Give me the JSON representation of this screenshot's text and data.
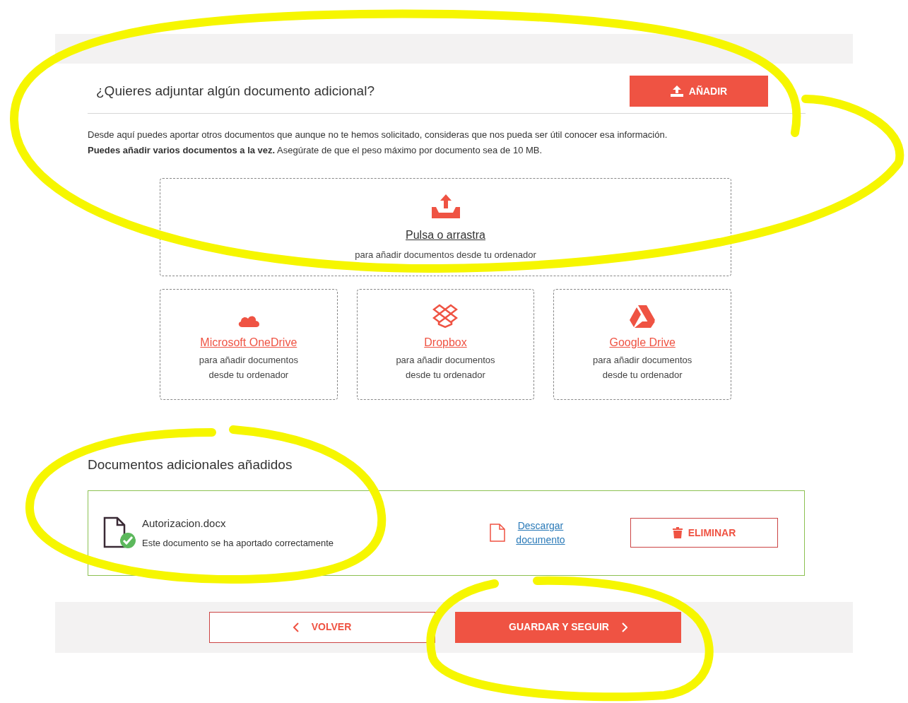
{
  "header": {
    "title": "¿Quieres adjuntar algún documento adicional?",
    "add_button": "AÑADIR"
  },
  "intro": [
    "Desde aquí puedes aportar otros documentos que aunque no te hemos solicitado, consideras que nos pueda ser útil conocer esa información.",
    "**Puedes añadir varios documentos a la vez.** Asegúrate de que el peso máximo por documento sea de 10 MB."
  ],
  "dropzone": {
    "link": "Pulsa o arrastra",
    "hint": "para añadir documentos desde tu ordenador"
  },
  "providers": [
    {
      "kind": "onedrive",
      "link": "Microsoft OneDrive",
      "hint": "para añadir documentos desde tu ordenador"
    },
    {
      "kind": "dropbox",
      "link": "Dropbox",
      "hint": "para añadir documentos desde tu ordenador"
    },
    {
      "kind": "gdrive",
      "link": "Google Drive",
      "hint": "para añadir documentos desde tu ordenador"
    }
  ],
  "added": {
    "title": "Documentos adicionales añadidos",
    "documents": [
      {
        "name": "Autorizacion.docx",
        "status": "Este documento se ha aportado correctamente",
        "uploaded": true,
        "download": "Descargar documento",
        "delete": "ELIMINAR"
      }
    ]
  },
  "footer": {
    "back": "VOLVER",
    "next": "GUARDAR Y SEGUIR"
  }
}
